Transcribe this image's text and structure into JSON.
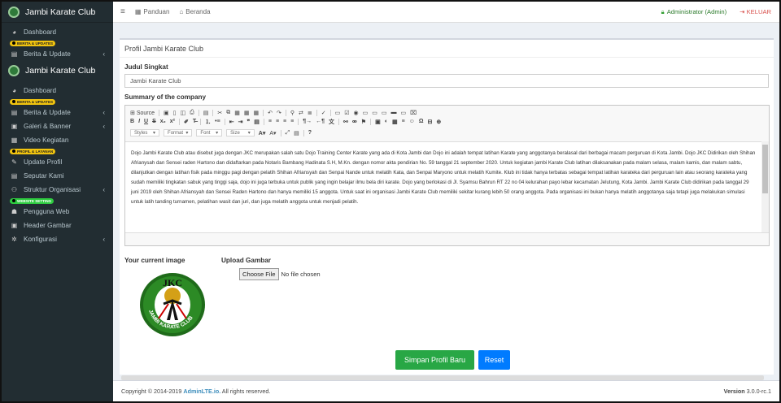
{
  "sidebar": {
    "brand": "Jambi Karate Club",
    "brand_repeat": "Jambi Karate Club",
    "items_top": [
      {
        "label": "Dashboard",
        "icon": "dashboard-icon",
        "glyph": "◕"
      },
      {
        "tag": "BERITA & UPDATES"
      },
      {
        "label": "Berita & Update",
        "icon": "newspaper-icon",
        "glyph": "▤",
        "caret": "‹"
      }
    ],
    "dashboard": "Dashboard",
    "tag_berita": "BERITA & UPDATES",
    "berita": "Berita & Update",
    "galeri": "Galeri & Banner",
    "video": "Video Kegiatan",
    "tag_profil": "PROFIL & LAYANAN",
    "update_profil": "Update Profil",
    "seputar": "Seputar Kami",
    "struktur": "Struktur Organisasi",
    "tag_website": "WEBSITE SETTING",
    "pengguna": "Pengguna Web",
    "header_gambar": "Header Gambar",
    "konfigurasi": "Konfigurasi",
    "caret": "‹"
  },
  "topbar": {
    "menu_icon": "≡",
    "panduan": "Panduan",
    "beranda": "Beranda",
    "admin": "Administrator (Admin)",
    "logout": "KELUAR"
  },
  "box": {
    "title": "Profil Jambi Karate Club",
    "judul_label": "Judul Singkat",
    "judul_value": "Jambi Karate Club",
    "summary_label": "Summary of the company",
    "toolbar": {
      "source": "Source",
      "styles": "Styles",
      "format": "Format",
      "font": "Font",
      "size": "Size"
    },
    "editor_text": "Dojo Jambi Karate Club atau disebut juga dengan JKC merupakan salah satu Dojo Training Center Karate yang ada di Kota Jambi dan Dojo ini adalah tempat latihan Karate yang anggotanya beralasal dari berbagai macam perguruan di Kota Jambi. Dojo JKC Didirikan oleh Shihan Afrianysah dan Sensei raden Hartono dan didaftarkan pada Notaris Bambang Hadinata S.H, M.Kn. dengan nomor akta pendirian No. 59 tanggal 21 september 2020. Untuk kegiatan jambi Karate Club latihan dilaksanakan pada malam selasa, malam kamis, dan malam sabtu, dilanjutkan dengan latihan fisik pada minggu pagi dengan pelatih Shihan Afriansyah dan Senpai Nande untuk melatih Kata, dan Senpai Maryono untuk melatih Kumite. Klub ini tidak hanya terbatas sebagai tempat latihan karateka dari perguruan lain atau seorang karateka yang sudah memiliki tingkatan sabuk yang tinggi saja, dojo ini juga terbuka untuk publik yang ingin belajar ilmu bela diri karate. Dojo yang berlokasi di Jl. Syamsu Bahrun RT 22 no 04 kelurahan payo lebar kecamatan Jelutung, Kota Jambi. Jambi Karate Club didirikan pada tanggal 29 juni 2019 oleh Shihan Afriansyah dan Sensei Raden Hartono dan hanya memiliki 15 anggota. Untuk saat ini organisasi Jambi Karate Club memiliki sekitar kurang lebih 50 orang anggota. Pada organisasi ini bukan hanya melatih anggotanya saja tetapi juga melakukan simulasi untuk latih tanding turnamen, pelatihan wasit dan juri, dan juga melatih anggota untuk menjadi pelatih.",
    "current_image_label": "Your current image",
    "upload_label": "Upload Gambar",
    "choose_file": "Choose File",
    "no_file": "No file chosen",
    "logo_top": "JKC",
    "logo_arc": "JAMBI KARATE CLUB",
    "save_button": "Simpan Profil Baru",
    "reset_button": "Reset"
  },
  "footer": {
    "copyright_prefix": "Copyright © 2014-2019 ",
    "brand": "AdminLTE.io.",
    "rights": " All rights reserved.",
    "version_label": "Version",
    "version_value": " 3.0.0-rc.1"
  },
  "colors": {
    "sidebar_bg": "#222d32",
    "save_green": "#28a745",
    "reset_blue": "#007bff",
    "logout_red": "#d9534f",
    "admin_green": "#2b7a2b"
  }
}
